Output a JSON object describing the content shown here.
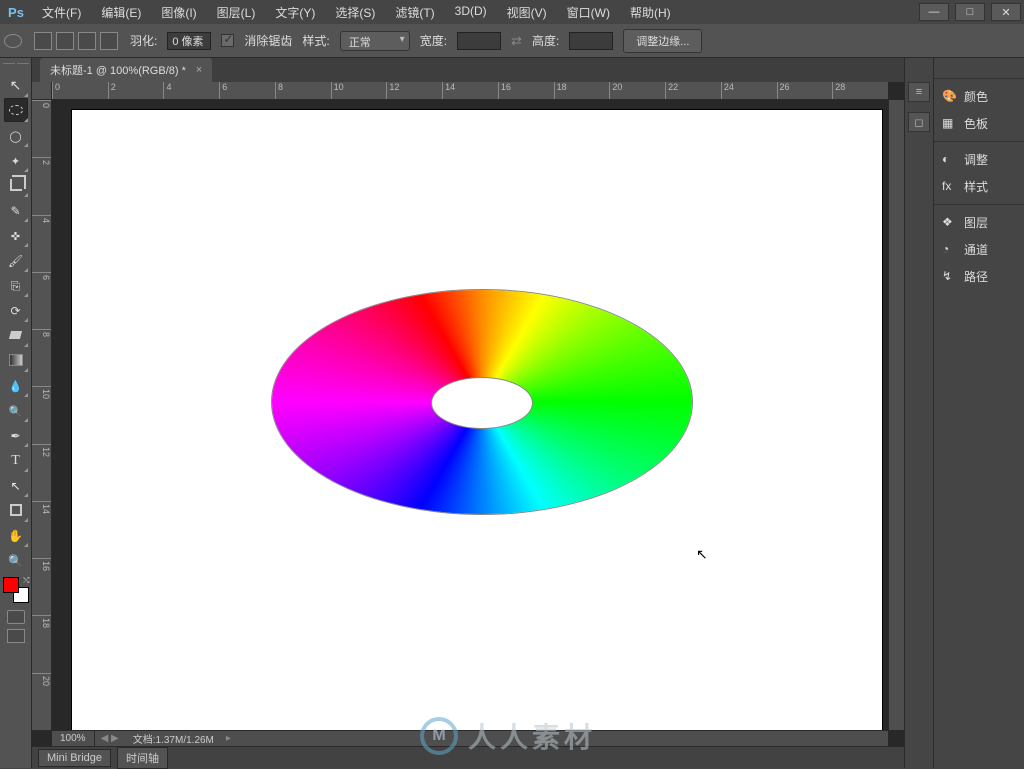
{
  "app": {
    "logo": "Ps"
  },
  "menu": [
    "文件(F)",
    "编辑(E)",
    "图像(I)",
    "图层(L)",
    "文字(Y)",
    "选择(S)",
    "滤镜(T)",
    "3D(D)",
    "视图(V)",
    "窗口(W)",
    "帮助(H)"
  ],
  "window_controls": {
    "min": "—",
    "max": "□",
    "close": "✕"
  },
  "options": {
    "feather_label": "羽化:",
    "feather_value": "0 像素",
    "antialias_label": "消除锯齿",
    "style_label": "样式:",
    "style_value": "正常",
    "width_label": "宽度:",
    "width_value": "",
    "height_label": "高度:",
    "height_value": "",
    "refine_btn": "调整边缘..."
  },
  "document": {
    "tab_title": "未标题-1 @ 100%(RGB/8) *",
    "zoom": "100%",
    "docsize": "文档:1.37M/1.26M"
  },
  "ruler_h": [
    "0",
    "2",
    "4",
    "6",
    "8",
    "10",
    "12",
    "14",
    "16",
    "18",
    "20",
    "22",
    "24",
    "26",
    "28"
  ],
  "ruler_v": [
    "0",
    "2",
    "4",
    "6",
    "8",
    "10",
    "12",
    "14",
    "16",
    "18",
    "20"
  ],
  "bottom_tabs": [
    "Mini Bridge",
    "时间轴"
  ],
  "panels": {
    "group1": [
      {
        "icon": "palette",
        "label": "颜色"
      },
      {
        "icon": "swatch",
        "label": "色板"
      }
    ],
    "group2": [
      {
        "icon": "adjust",
        "label": "调整"
      },
      {
        "icon": "fx",
        "label": "样式"
      }
    ],
    "group3": [
      {
        "icon": "layers",
        "label": "图层"
      },
      {
        "icon": "channels",
        "label": "通道"
      },
      {
        "icon": "paths",
        "label": "路径"
      }
    ]
  },
  "watermark": {
    "mark": "M",
    "text": "人人素材"
  }
}
